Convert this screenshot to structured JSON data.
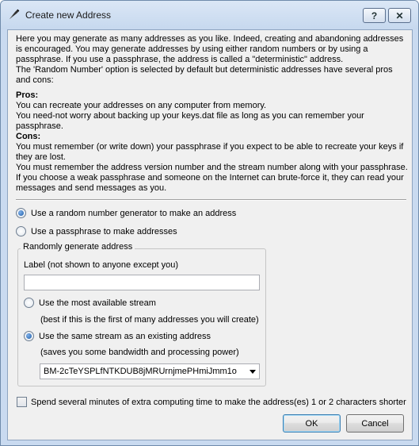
{
  "window": {
    "title": "Create new Address",
    "help_label": "?",
    "close_label": "✕"
  },
  "intro": {
    "p1": "Here you may generate as many addresses as you like. Indeed, creating and abandoning addresses is encouraged. You may generate addresses by using either random numbers or by using a passphrase. If you use a passphrase, the address is called a \"deterministic\" address.",
    "p2": "The 'Random Number' option is selected by default but deterministic addresses have several pros and cons:",
    "pros_heading": "Pros:",
    "pro1": "You can recreate your addresses on any computer from memory.",
    "pro2": "You need-not worry about backing up your keys.dat file as long as you can remember your passphrase.",
    "cons_heading": "Cons:",
    "con1": "You must remember (or write down) your passphrase if you expect to be able to recreate your keys if they are lost.",
    "con2": "You must remember the address version number and the stream number along with your passphrase.",
    "con3": "If you choose a weak passphrase and someone on the Internet can brute-force it, they can read your messages and send messages as you."
  },
  "options": {
    "random_label": "Use a random number generator to make an address",
    "random_selected": true,
    "passphrase_label": "Use a passphrase to make addresses",
    "passphrase_selected": false
  },
  "group": {
    "title": "Randomly generate address",
    "label_caption": "Label (not shown to anyone except you)",
    "label_value": "",
    "most_available_label": "Use the most available stream",
    "most_available_selected": false,
    "most_available_hint": "(best if this is the first of many addresses you will create)",
    "same_stream_label": "Use the same stream as an existing address",
    "same_stream_selected": true,
    "same_stream_hint": "(saves you some bandwidth and processing power)",
    "existing_address": "BM-2cTeYSPLfNTKDUB8jMRUrnjmePHmiJmm1o"
  },
  "extra": {
    "shorter_label": "Spend several minutes of extra computing time to make the address(es) 1 or 2 characters shorter",
    "shorter_checked": false
  },
  "buttons": {
    "ok": "OK",
    "cancel": "Cancel"
  }
}
